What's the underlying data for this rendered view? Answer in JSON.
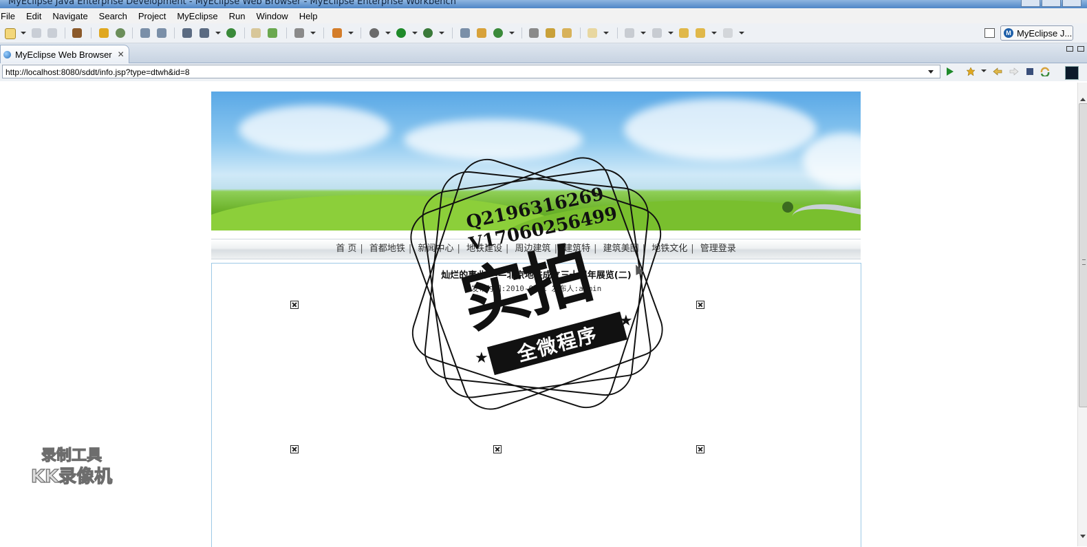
{
  "window": {
    "title": "MyEclipse Java Enterprise Development - MyEclipse Web Browser - MyEclipse Enterprise Workbench"
  },
  "menu": [
    "File",
    "Edit",
    "Navigate",
    "Search",
    "Project",
    "MyEclipse",
    "Run",
    "Window",
    "Help"
  ],
  "toolbar": {
    "perspective_label": "MyEclipse J...",
    "icons": [
      "new-icon",
      "save-icon",
      "save-all-icon",
      "package-icon",
      "debug-config-icon",
      "deploy-icon",
      "server-icon",
      "search-icon",
      "wizard-icon",
      "web-project-icon",
      "globe-icon",
      "open-folder-icon",
      "open-file-icon",
      "image-icon",
      "new-project-icon",
      "debug-icon",
      "run-icon",
      "external-tools-icon",
      "hierarchy-icon",
      "plugin-icon",
      "refresh-icon",
      "connect-icon",
      "rocket-icon",
      "deploy-box-icon",
      "folder-icon",
      "prev-annotation-icon",
      "next-annotation-icon",
      "back-history-icon",
      "back-icon",
      "forward-icon"
    ],
    "colors": {
      "run": "#1f8a2a",
      "accent": "#1e5fa8"
    }
  },
  "editor_tab": {
    "label": "MyEclipse Web Browser",
    "close_symbol": "✕"
  },
  "browser": {
    "url": "http://localhost:8080/sddt/info.jsp?type=dtwh&id=8"
  },
  "site": {
    "nav": [
      "首 页",
      "首都地铁",
      "新闻中心",
      "地铁建设",
      "周边建筑",
      "建筑特",
      "建筑美图",
      "地铁文化",
      "管理登录"
    ],
    "nav_separator": "|",
    "article_title": "灿烂的事业 ——北京地铁成立三十周年展览(二)",
    "article_meta": "发布时间:2010-05-1 发布人:admin"
  },
  "overlay_stamp": {
    "line1": "Q2196316269",
    "line2": "V17060256499",
    "big": "实拍",
    "ribbon": "全微程序",
    "star": "★"
  },
  "watermark": {
    "line1": "录制工具",
    "line2": "KK录像机"
  }
}
